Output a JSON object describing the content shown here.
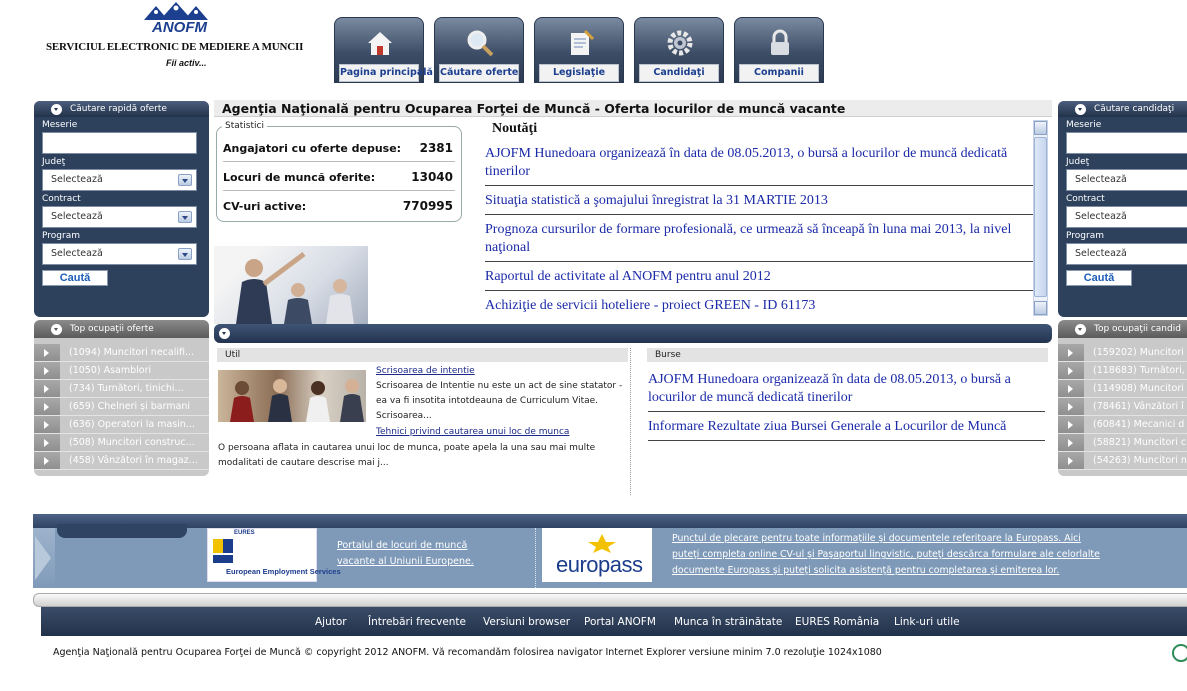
{
  "header": {
    "logo_text": "ANOFM",
    "site_title": "SERVICIUL ELECTRONIC DE MEDIERE A MUNCII",
    "slogan": "Fii activ...",
    "tabs": [
      {
        "label": "Pagina principală",
        "icon": "home-icon"
      },
      {
        "label": "Căutare oferte",
        "icon": "search-icon"
      },
      {
        "label": "Legislaţie",
        "icon": "document-icon"
      },
      {
        "label": "Candidaţi",
        "icon": "gear-icon"
      },
      {
        "label": "Companii",
        "icon": "lock-icon"
      }
    ]
  },
  "left_search": {
    "title": "Căutare rapidă oferte",
    "meserie_label": "Meserie",
    "judet_label": "Judeţ",
    "judet_value": "Selectează",
    "contract_label": "Contract",
    "contract_value": "Selectează",
    "program_label": "Program",
    "program_value": "Selectează",
    "button": "Caută"
  },
  "left_top": {
    "title": "Top ocupaţii oferte",
    "items": [
      "(1094) Muncitori necalifi...",
      "(1050) Asamblori",
      "(734) Turnători, tinichi...",
      "(659) Chelneri și barmani",
      "(636) Operatori la masin...",
      "(508) Muncitori construc...",
      "(458) Vânzători în magaz..."
    ]
  },
  "right_search": {
    "title": "Căutare candidaţi",
    "meserie_label": "Meserie",
    "judet_label": "Judeţ",
    "judet_value": "Selectează",
    "contract_label": "Contract",
    "contract_value": "Selectează",
    "program_label": "Program",
    "program_value": "Selectează",
    "button": "Caută"
  },
  "right_top": {
    "title": "Top ocupaţii candid",
    "items": [
      "(159202) Muncitori",
      "(118683) Turnători,",
      "(114908) Muncitori",
      "(78461) Vânzători î",
      "(60841) Mecanici d",
      "(58821) Muncitori c",
      "(54263) Muncitori n"
    ]
  },
  "main": {
    "title": "Agenţia Naţională pentru Ocuparea Forţei de Muncă - Oferta locurilor de muncă vacante",
    "stats": {
      "legend": "Statistici",
      "rows": [
        {
          "label": "Angajatori cu oferte depuse:",
          "value": "2381"
        },
        {
          "label": "Locuri de muncă oferite:",
          "value": "13040"
        },
        {
          "label": "CV-uri active:",
          "value": "770995"
        }
      ]
    },
    "news_title": "Noutăţi",
    "news": [
      "AJOFM Hunedoara organizează în data de 08.05.2013, o bursă a locurilor de muncă dedicată tinerilor",
      "Situaţia statistică a şomajului înregistrat la 31 MARTIE 2013",
      "Prognoza cursurilor de formare profesională, ce urmează să înceapă în luna mai 2013, la nivel naţional",
      "Raportul de activitate al ANOFM pentru anul 2012",
      "Achiziţie de servicii hoteliere - proiect GREEN - ID 61173"
    ]
  },
  "util": {
    "title": "Util",
    "link1": "Scrisoarea de intentie",
    "text1_line1": "Scrisoarea de Intentie nu este un act de sine statator -",
    "text1_line2": "ea va fi insotita intotdeauna de Curriculum Vitae.",
    "text1_line3": "Scrisoarea...",
    "link2": "Tehnici privind cautarea unui loc de munca",
    "text2_line1": "O persoana aflata in cautarea unui loc de munca, poate apela la una sau mai multe",
    "text2_line2": "modalitati de cautare descrise mai j..."
  },
  "burse": {
    "title": "Burse",
    "items": [
      "AJOFM Hunedoara organizează în data de 08.05.2013, o bursă a locurilor de muncă dedicată tinerilor",
      "Informare Rezultate ziua Bursei Generale a Locurilor de Muncă"
    ]
  },
  "eures": {
    "logo_top": "EURES",
    "logo_text": "European Employment Services",
    "link_line1": "Portalul de locuri de muncă",
    "link_line2": "vacante al Uniunii Europene.",
    "europass_logo": "europass",
    "europass_line1": "Punctul de plecare pentru toate informaţiile şi documentele referitoare la Europass. Aici",
    "europass_line2": "puteţi completa online CV-ul şi Paşaportul lingvistic, puteţi descărca formulare ale celorlalte",
    "europass_line3": "documente Europass şi puteţi solicita asistenţă pentru completarea şi emiterea lor."
  },
  "footer": {
    "nav": [
      "Ajutor",
      "Întrebări frecvente",
      "Versiuni browser",
      "Portal ANOFM",
      "Munca în străinătate",
      "EURES România",
      "Link-uri utile"
    ],
    "copyright": "Agenţia Naţională pentru Ocuparea Forţei de Muncă © copyright 2012 ANOFM. Vă recomandăm folosirea navigator Internet Explorer versiune minim 7.0 rezoluţie 1024x1080"
  },
  "colors": {
    "panel_dark": "#2d415d",
    "link_blue": "#1b2aa8",
    "top_gray": "#c9c9c9"
  }
}
